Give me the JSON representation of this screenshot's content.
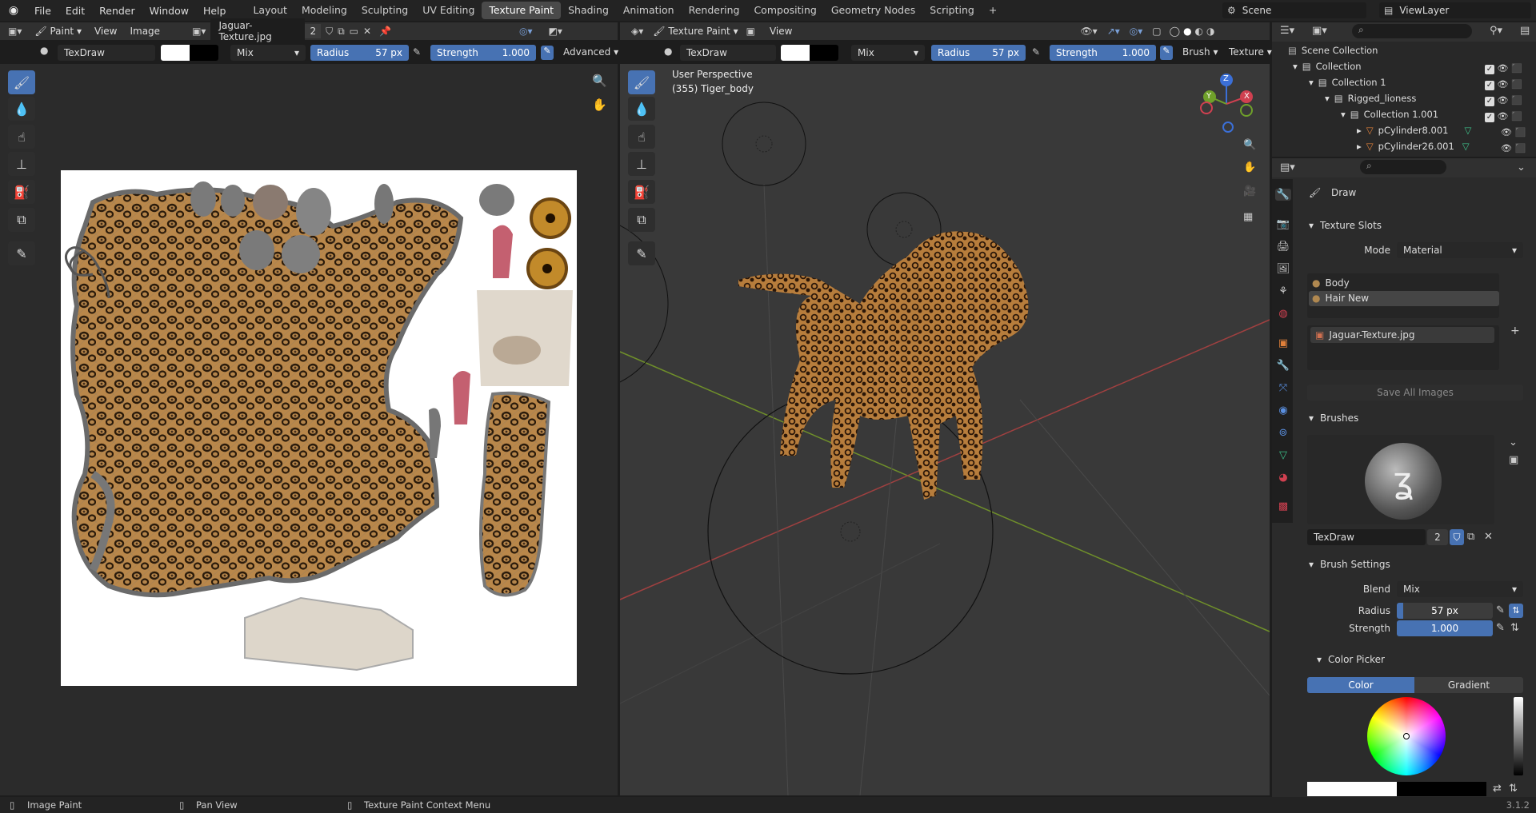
{
  "menu": {
    "file": "File",
    "edit": "Edit",
    "render": "Render",
    "window": "Window",
    "help": "Help"
  },
  "workspaces": [
    "Layout",
    "Modeling",
    "Sculpting",
    "UV Editing",
    "Texture Paint",
    "Shading",
    "Animation",
    "Rendering",
    "Compositing",
    "Geometry Nodes",
    "Scripting"
  ],
  "active_workspace": "Texture Paint",
  "add_workspace": "+",
  "scene": "Scene",
  "viewlayer": "ViewLayer",
  "image_editor": {
    "mode": "Paint",
    "view": "View",
    "image": "Image",
    "image_name": "Jaguar-Texture.jpg",
    "users": "2"
  },
  "tool_header_left": {
    "brush": "TexDraw",
    "blend": "Mix",
    "radius_label": "Radius",
    "radius": "57 px",
    "strength_label": "Strength",
    "strength": "1.000",
    "advanced": "Advanced"
  },
  "viewport": {
    "mode": "Texture Paint",
    "view": "View",
    "brush": "TexDraw",
    "blend": "Mix",
    "radius_label": "Radius",
    "radius": "57 px",
    "strength_label": "Strength",
    "strength": "1.000",
    "brush_menu": "Brush",
    "texture_menu": "Texture",
    "perspective": "User Perspective",
    "object": "(355) Tiger_body"
  },
  "gizmo": {
    "x": "X",
    "y": "Y",
    "z": "Z"
  },
  "outliner": {
    "root": "Scene Collection",
    "items": [
      {
        "label": "Collection"
      },
      {
        "label": "Collection 1"
      },
      {
        "label": "Rigged_lioness"
      },
      {
        "label": "Collection 1.001"
      },
      {
        "label": "pCylinder8.001"
      },
      {
        "label": "pCylinder26.001"
      }
    ]
  },
  "properties": {
    "tool_name": "Draw",
    "texture_slots": {
      "title": "Texture Slots",
      "mode_label": "Mode",
      "mode": "Material",
      "slots": [
        "Body",
        "Hair New"
      ],
      "image": "Jaguar-Texture.jpg",
      "save_all": "Save All Images"
    },
    "brushes": {
      "title": "Brushes",
      "name": "TexDraw",
      "users": "2"
    },
    "brush_settings": {
      "title": "Brush Settings",
      "blend_label": "Blend",
      "blend": "Mix",
      "radius_label": "Radius",
      "radius": "57 px",
      "strength_label": "Strength",
      "strength": "1.000"
    },
    "color_picker": {
      "title": "Color Picker",
      "tab_color": "Color",
      "tab_gradient": "Gradient"
    }
  },
  "status": {
    "left": "Image Paint",
    "mid": "Pan View",
    "right": "Texture Paint Context Menu",
    "version": "3.1.2"
  },
  "colors": {
    "accent": "#4772b3",
    "bg": "#1d1d1d",
    "panel": "#303030"
  }
}
